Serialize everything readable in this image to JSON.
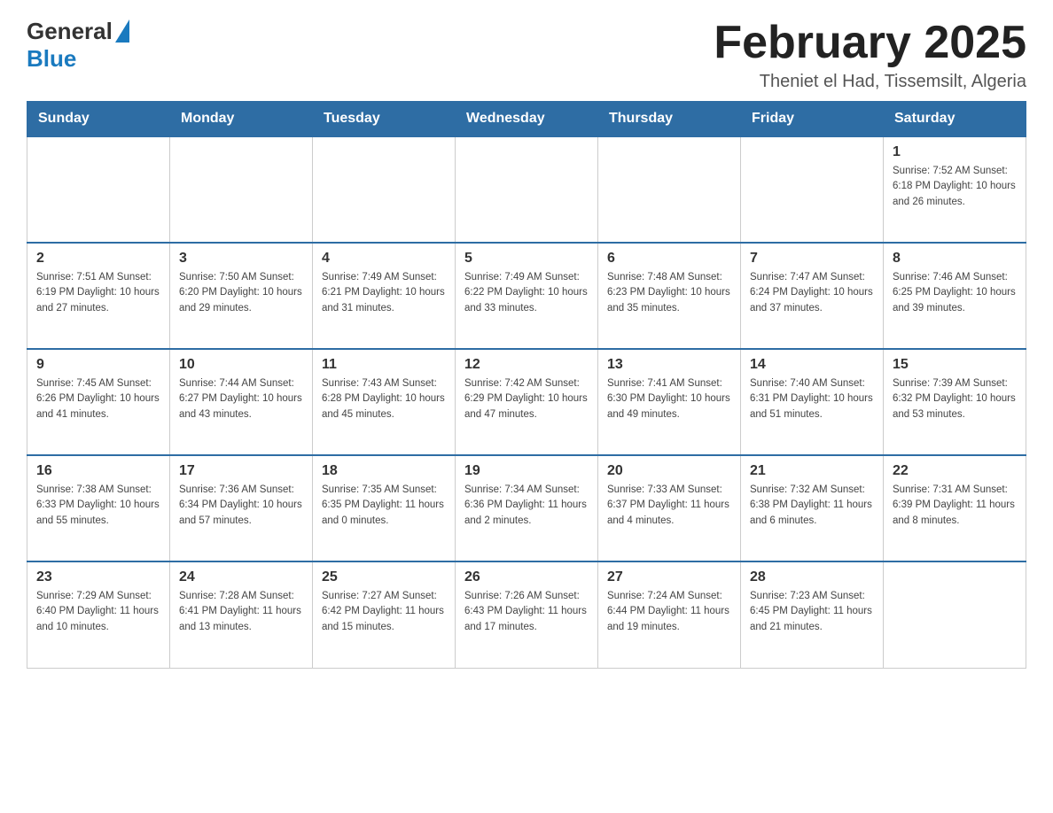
{
  "header": {
    "logo_general": "General",
    "logo_blue": "Blue",
    "main_title": "February 2025",
    "subtitle": "Theniet el Had, Tissemsilt, Algeria"
  },
  "days_of_week": [
    "Sunday",
    "Monday",
    "Tuesday",
    "Wednesday",
    "Thursday",
    "Friday",
    "Saturday"
  ],
  "weeks": [
    [
      {
        "day": "",
        "info": ""
      },
      {
        "day": "",
        "info": ""
      },
      {
        "day": "",
        "info": ""
      },
      {
        "day": "",
        "info": ""
      },
      {
        "day": "",
        "info": ""
      },
      {
        "day": "",
        "info": ""
      },
      {
        "day": "1",
        "info": "Sunrise: 7:52 AM\nSunset: 6:18 PM\nDaylight: 10 hours and 26 minutes."
      }
    ],
    [
      {
        "day": "2",
        "info": "Sunrise: 7:51 AM\nSunset: 6:19 PM\nDaylight: 10 hours and 27 minutes."
      },
      {
        "day": "3",
        "info": "Sunrise: 7:50 AM\nSunset: 6:20 PM\nDaylight: 10 hours and 29 minutes."
      },
      {
        "day": "4",
        "info": "Sunrise: 7:49 AM\nSunset: 6:21 PM\nDaylight: 10 hours and 31 minutes."
      },
      {
        "day": "5",
        "info": "Sunrise: 7:49 AM\nSunset: 6:22 PM\nDaylight: 10 hours and 33 minutes."
      },
      {
        "day": "6",
        "info": "Sunrise: 7:48 AM\nSunset: 6:23 PM\nDaylight: 10 hours and 35 minutes."
      },
      {
        "day": "7",
        "info": "Sunrise: 7:47 AM\nSunset: 6:24 PM\nDaylight: 10 hours and 37 minutes."
      },
      {
        "day": "8",
        "info": "Sunrise: 7:46 AM\nSunset: 6:25 PM\nDaylight: 10 hours and 39 minutes."
      }
    ],
    [
      {
        "day": "9",
        "info": "Sunrise: 7:45 AM\nSunset: 6:26 PM\nDaylight: 10 hours and 41 minutes."
      },
      {
        "day": "10",
        "info": "Sunrise: 7:44 AM\nSunset: 6:27 PM\nDaylight: 10 hours and 43 minutes."
      },
      {
        "day": "11",
        "info": "Sunrise: 7:43 AM\nSunset: 6:28 PM\nDaylight: 10 hours and 45 minutes."
      },
      {
        "day": "12",
        "info": "Sunrise: 7:42 AM\nSunset: 6:29 PM\nDaylight: 10 hours and 47 minutes."
      },
      {
        "day": "13",
        "info": "Sunrise: 7:41 AM\nSunset: 6:30 PM\nDaylight: 10 hours and 49 minutes."
      },
      {
        "day": "14",
        "info": "Sunrise: 7:40 AM\nSunset: 6:31 PM\nDaylight: 10 hours and 51 minutes."
      },
      {
        "day": "15",
        "info": "Sunrise: 7:39 AM\nSunset: 6:32 PM\nDaylight: 10 hours and 53 minutes."
      }
    ],
    [
      {
        "day": "16",
        "info": "Sunrise: 7:38 AM\nSunset: 6:33 PM\nDaylight: 10 hours and 55 minutes."
      },
      {
        "day": "17",
        "info": "Sunrise: 7:36 AM\nSunset: 6:34 PM\nDaylight: 10 hours and 57 minutes."
      },
      {
        "day": "18",
        "info": "Sunrise: 7:35 AM\nSunset: 6:35 PM\nDaylight: 11 hours and 0 minutes."
      },
      {
        "day": "19",
        "info": "Sunrise: 7:34 AM\nSunset: 6:36 PM\nDaylight: 11 hours and 2 minutes."
      },
      {
        "day": "20",
        "info": "Sunrise: 7:33 AM\nSunset: 6:37 PM\nDaylight: 11 hours and 4 minutes."
      },
      {
        "day": "21",
        "info": "Sunrise: 7:32 AM\nSunset: 6:38 PM\nDaylight: 11 hours and 6 minutes."
      },
      {
        "day": "22",
        "info": "Sunrise: 7:31 AM\nSunset: 6:39 PM\nDaylight: 11 hours and 8 minutes."
      }
    ],
    [
      {
        "day": "23",
        "info": "Sunrise: 7:29 AM\nSunset: 6:40 PM\nDaylight: 11 hours and 10 minutes."
      },
      {
        "day": "24",
        "info": "Sunrise: 7:28 AM\nSunset: 6:41 PM\nDaylight: 11 hours and 13 minutes."
      },
      {
        "day": "25",
        "info": "Sunrise: 7:27 AM\nSunset: 6:42 PM\nDaylight: 11 hours and 15 minutes."
      },
      {
        "day": "26",
        "info": "Sunrise: 7:26 AM\nSunset: 6:43 PM\nDaylight: 11 hours and 17 minutes."
      },
      {
        "day": "27",
        "info": "Sunrise: 7:24 AM\nSunset: 6:44 PM\nDaylight: 11 hours and 19 minutes."
      },
      {
        "day": "28",
        "info": "Sunrise: 7:23 AM\nSunset: 6:45 PM\nDaylight: 11 hours and 21 minutes."
      },
      {
        "day": "",
        "info": ""
      }
    ]
  ]
}
